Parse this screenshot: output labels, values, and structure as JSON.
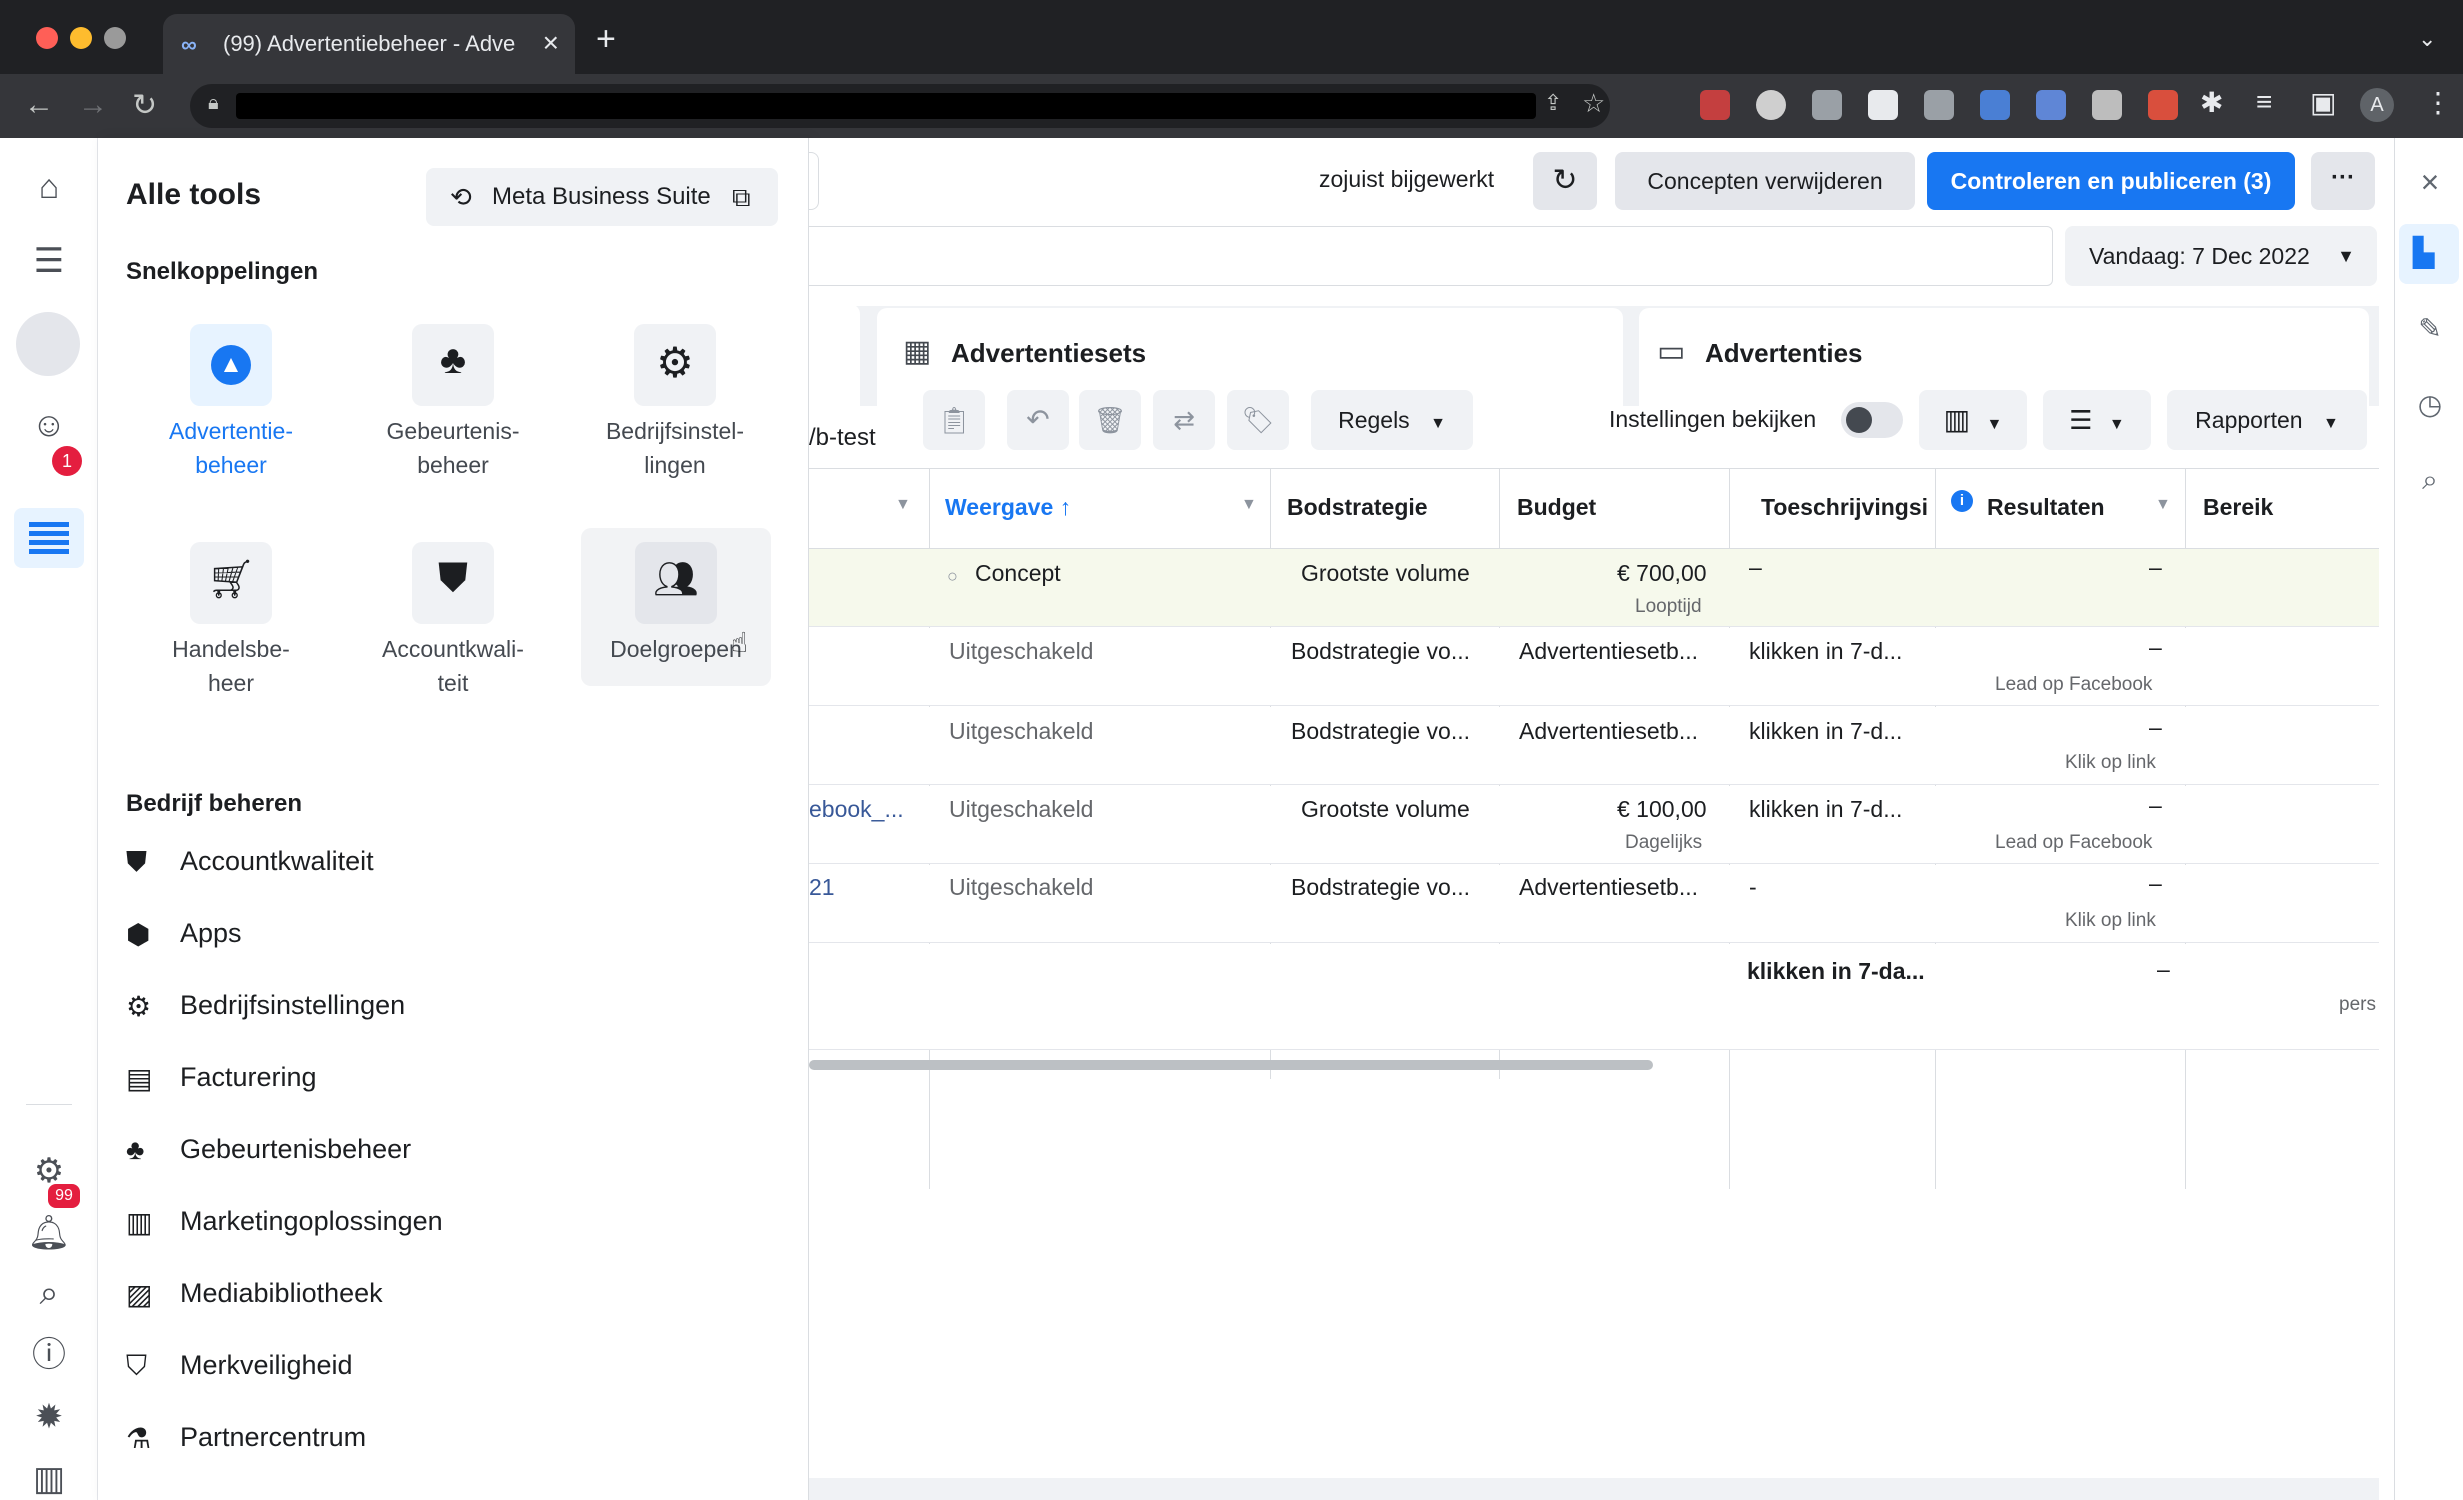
{
  "browser": {
    "tab_title": "(99) Advertentiebeheer - Adve",
    "new_tab": "+",
    "profile_initial": "A"
  },
  "rail": {
    "notification_badge": "1",
    "bell_badge": "99"
  },
  "panel": {
    "title": "Alle tools",
    "mbs_button": "Meta Business Suite",
    "shortcuts_title": "Snelkoppelingen",
    "shortcuts": [
      {
        "label": "Advertentie-\nbeheer",
        "icon": "ads-manager-icon"
      },
      {
        "label": "Gebeurtenis-\nbeheer",
        "icon": "events-manager-icon"
      },
      {
        "label": "Bedrijfsinstel-\nlingen",
        "icon": "gear-icon"
      },
      {
        "label": "Handelsbe-\nheer",
        "icon": "cart-icon"
      },
      {
        "label": "Accountkwali-\nteit",
        "icon": "shield-icon"
      },
      {
        "label": "Doelgroepen",
        "icon": "audience-icon"
      }
    ],
    "manage_title": "Bedrijf beheren",
    "manage_items": [
      {
        "label": "Accountkwaliteit",
        "icon": "shield-icon"
      },
      {
        "label": "Apps",
        "icon": "cube-icon"
      },
      {
        "label": "Bedrijfsinstellingen",
        "icon": "gear-icon"
      },
      {
        "label": "Facturering",
        "icon": "billing-icon"
      },
      {
        "label": "Gebeurtenisbeheer",
        "icon": "events-manager-icon"
      },
      {
        "label": "Marketingoplossingen",
        "icon": "book-icon"
      },
      {
        "label": "Mediabibliotheek",
        "icon": "image-icon"
      },
      {
        "label": "Merkveiligheid",
        "icon": "brand-safety-icon"
      },
      {
        "label": "Partnercentrum",
        "icon": "flask-icon"
      }
    ]
  },
  "topbar": {
    "status": "zojuist bijgewerkt",
    "discard_button": "Concepten verwijderen",
    "publish_button": "Controleren en publiceren (3)",
    "more_button": "···",
    "date_button": "Vandaag: 7 Dec 2022"
  },
  "tabs": {
    "adsets": "Advertentiesets",
    "ads": "Advertenties"
  },
  "toolbar": {
    "ab_test": "/b-test",
    "rules": "Regels",
    "view_settings": "Instellingen bekijken",
    "reports": "Rapporten"
  },
  "table": {
    "headers": {
      "delivery": "Weergave ↑",
      "bid": "Bodstrategie",
      "budget": "Budget",
      "attribution": "Toeschrijvingsi",
      "results": "Resultaten",
      "reach": "Bereik"
    },
    "rows": [
      {
        "name": "",
        "delivery": "Concept",
        "bid": "Grootste volume",
        "budget": "€ 700,00",
        "budget_sub": "Looptijd",
        "attribution": "–",
        "results": "–",
        "results_sub": ""
      },
      {
        "name": "",
        "delivery": "Uitgeschakeld",
        "bid": "Bodstrategie vo...",
        "budget": "Advertentiesetb...",
        "budget_sub": "",
        "attribution": "klikken in 7-d...",
        "results": "–",
        "results_sub": "Lead op Facebook"
      },
      {
        "name": "",
        "delivery": "Uitgeschakeld",
        "bid": "Bodstrategie vo...",
        "budget": "Advertentiesetb...",
        "budget_sub": "",
        "attribution": "klikken in 7-d...",
        "results": "–",
        "results_sub": "Klik op link"
      },
      {
        "name": "ebook_...",
        "delivery": "Uitgeschakeld",
        "bid": "Grootste volume",
        "budget": "€ 100,00",
        "budget_sub": "Dagelijks",
        "attribution": "klikken in 7-d...",
        "results": "–",
        "results_sub": "Lead op Facebook"
      },
      {
        "name": "21",
        "delivery": "Uitgeschakeld",
        "bid": "Bodstrategie vo...",
        "budget": "Advertentiesetb...",
        "budget_sub": "",
        "attribution": "-",
        "results": "–",
        "results_sub": "Klik op link"
      }
    ],
    "total": {
      "attribution": "klikken in 7-da...",
      "results": "–",
      "reach_sub": "pers"
    }
  },
  "colors": {
    "brand_blue": "#1877f2",
    "concept_row": "#f6f9ec",
    "badge_red": "#e41e3f"
  }
}
